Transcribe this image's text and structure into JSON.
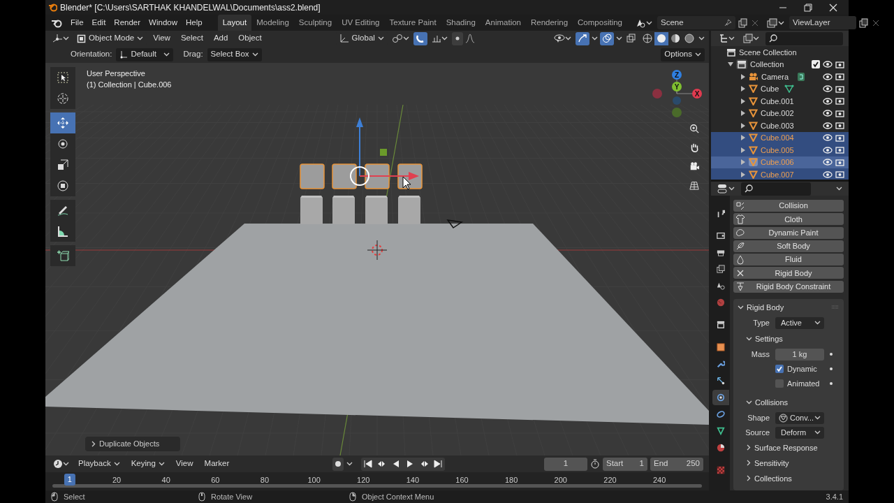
{
  "window": {
    "title": "Blender* [C:\\Users\\SARTHAK KHANDELWAL\\Documents\\ass2.blend]"
  },
  "menu": [
    "File",
    "Edit",
    "Render",
    "Window",
    "Help"
  ],
  "workspaces": [
    {
      "label": "Layout",
      "selected": true
    },
    {
      "label": "Modeling",
      "selected": false
    },
    {
      "label": "Sculpting",
      "selected": false
    },
    {
      "label": "UV Editing",
      "selected": false
    },
    {
      "label": "Texture Paint",
      "selected": false
    },
    {
      "label": "Shading",
      "selected": false
    },
    {
      "label": "Animation",
      "selected": false
    },
    {
      "label": "Rendering",
      "selected": false
    },
    {
      "label": "Compositing",
      "selected": false
    }
  ],
  "scene": "Scene",
  "view_layer": "ViewLayer",
  "viewport_header": {
    "mode": "Object Mode",
    "menus": [
      "View",
      "Select",
      "Add",
      "Object"
    ],
    "transform_orientation": "Global",
    "snap": {
      "on": true
    },
    "gizmos": {
      "on": true
    },
    "overlays": {
      "on": true
    },
    "xray": {
      "on": false
    },
    "shading": [
      {
        "kind": "wireframe",
        "selected": false
      },
      {
        "kind": "solid",
        "selected": true
      },
      {
        "kind": "material",
        "selected": false
      },
      {
        "kind": "rendered",
        "selected": false
      }
    ]
  },
  "tool_settings": {
    "orientation_label": "Orientation:",
    "orientation": "Default",
    "drag_label": "Drag:",
    "drag": "Select Box",
    "options": "Options"
  },
  "viewport": {
    "view_name": "User Perspective",
    "context": "(1) Collection | Cube.006",
    "axes": [
      "X",
      "Y",
      "Z"
    ],
    "last_operator": "Duplicate Objects",
    "tools": [
      {
        "kind": "select",
        "selected": false
      },
      {
        "kind": "cursor",
        "selected": false
      },
      {
        "kind": "move",
        "selected": true
      },
      {
        "kind": "rotate",
        "selected": false
      },
      {
        "kind": "scale",
        "selected": false
      },
      {
        "kind": "transform",
        "selected": false
      },
      {
        "kind": "annotate",
        "selected": false
      },
      {
        "kind": "measure",
        "selected": false
      },
      {
        "kind": "add_cube",
        "selected": false
      }
    ]
  },
  "outliner": {
    "root": "Scene Collection",
    "children": [
      {
        "label": "Collection",
        "kind": "collection",
        "expanded": true,
        "checked": true,
        "children": [
          {
            "label": "Camera",
            "kind": "camera",
            "selected": false,
            "active": false,
            "linked_data": true
          },
          {
            "label": "Cube",
            "kind": "mesh",
            "selected": false,
            "active": false,
            "linked_data": true
          },
          {
            "label": "Cube.001",
            "kind": "mesh",
            "selected": false,
            "active": false,
            "linked_data": false
          },
          {
            "label": "Cube.002",
            "kind": "mesh",
            "selected": false,
            "active": false,
            "linked_data": false
          },
          {
            "label": "Cube.003",
            "kind": "mesh",
            "selected": false,
            "active": false,
            "linked_data": false
          },
          {
            "label": "Cube.004",
            "kind": "mesh",
            "selected": true,
            "active": false,
            "linked_data": false
          },
          {
            "label": "Cube.005",
            "kind": "mesh",
            "selected": true,
            "active": false,
            "linked_data": false
          },
          {
            "label": "Cube.006",
            "kind": "mesh",
            "selected": true,
            "active": true,
            "linked_data": false
          },
          {
            "label": "Cube.007",
            "kind": "mesh",
            "selected": true,
            "active": false,
            "linked_data": false
          }
        ]
      }
    ]
  },
  "properties": {
    "tabs": [
      {
        "kind": "tool",
        "selected": false
      },
      {
        "kind": "render",
        "selected": false
      },
      {
        "kind": "output",
        "selected": false
      },
      {
        "kind": "view_layer",
        "selected": false
      },
      {
        "kind": "scene",
        "selected": false
      },
      {
        "kind": "world",
        "selected": false
      },
      {
        "kind": "collection",
        "selected": false
      },
      {
        "kind": "object",
        "selected": false
      },
      {
        "kind": "modifiers",
        "selected": false
      },
      {
        "kind": "particles",
        "selected": false
      },
      {
        "kind": "physics",
        "selected": true
      },
      {
        "kind": "constraints",
        "selected": false
      },
      {
        "kind": "data",
        "selected": false
      },
      {
        "kind": "material",
        "selected": false
      },
      {
        "kind": "texture",
        "selected": false
      }
    ],
    "physics_buttons": [
      {
        "label": "Collision",
        "kind": "collision"
      },
      {
        "label": "Cloth",
        "kind": "cloth"
      },
      {
        "label": "Dynamic Paint",
        "kind": "paint"
      },
      {
        "label": "Soft Body",
        "kind": "soft"
      },
      {
        "label": "Fluid",
        "kind": "fluid"
      },
      {
        "label": "Rigid Body",
        "kind": "remove"
      },
      {
        "label": "Rigid Body Constraint",
        "kind": "constraint"
      }
    ],
    "panel": {
      "title": "Rigid Body",
      "expanded": true,
      "type_label": "Type",
      "type": "Active",
      "settings": {
        "title": "Settings",
        "expanded": true,
        "mass_label": "Mass",
        "mass": "1 kg",
        "dynamic": {
          "label": "Dynamic",
          "checked": true
        },
        "animated": {
          "label": "Animated",
          "checked": false
        }
      },
      "collisions": {
        "title": "Collisions",
        "expanded": true,
        "shape_label": "Shape",
        "shape": "Conv...",
        "source_label": "Source",
        "source": "Deform"
      },
      "subpanels": [
        {
          "title": "Surface Response",
          "expanded": false
        },
        {
          "title": "Sensitivity",
          "expanded": false
        },
        {
          "title": "Collections",
          "expanded": false
        }
      ]
    }
  },
  "timeline": {
    "menus": [
      "Playback",
      "Keying",
      "View",
      "Marker"
    ],
    "current_frame": "1",
    "start_label": "Start",
    "start": "1",
    "end_label": "End",
    "end": "250",
    "playhead": "1",
    "ticks": [
      "20",
      "40",
      "60",
      "80",
      "100",
      "120",
      "140",
      "160",
      "180",
      "200",
      "220",
      "240"
    ]
  },
  "status_bar": {
    "hints": [
      "Select",
      "Rotate View",
      "Object Context Menu"
    ],
    "version": "3.4.1"
  }
}
